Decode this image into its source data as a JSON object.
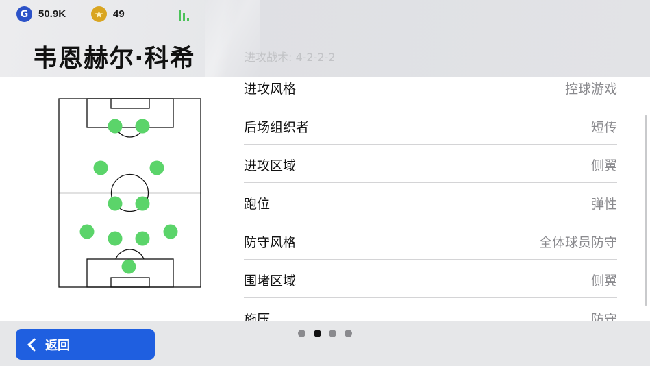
{
  "header": {
    "gp": {
      "icon": "g-coin-icon",
      "amount": "50.9K",
      "color": "#2c52c8"
    },
    "coins": {
      "icon": "star-coin-icon",
      "amount": "49",
      "color": "#d9a520"
    },
    "signal_icon": "signal-strength-icon",
    "player_name": "韦恩赫尔·科希",
    "tactic_faded": "进攻战术: 4-2-2-2"
  },
  "formation": {
    "name": "4-2-2-2",
    "player_dot_color": "#5bd46a"
  },
  "attributes": [
    {
      "label": "进攻风格",
      "value": "控球游戏"
    },
    {
      "label": "后场组织者",
      "value": "短传"
    },
    {
      "label": "进攻区域",
      "value": "侧翼"
    },
    {
      "label": "跑位",
      "value": "弹性"
    },
    {
      "label": "防守风格",
      "value": "全体球员防守"
    },
    {
      "label": "围堵区域",
      "value": "侧翼"
    },
    {
      "label": "施压",
      "value": "防守"
    }
  ],
  "footer": {
    "back_label": "返回",
    "back_icon": "chevron-left-icon",
    "pager": {
      "total": 4,
      "active": 2
    }
  },
  "colors": {
    "accent": "#1f5fe0",
    "header_bg": "#e4e5e8",
    "footer_bg": "#e6e7e9"
  }
}
